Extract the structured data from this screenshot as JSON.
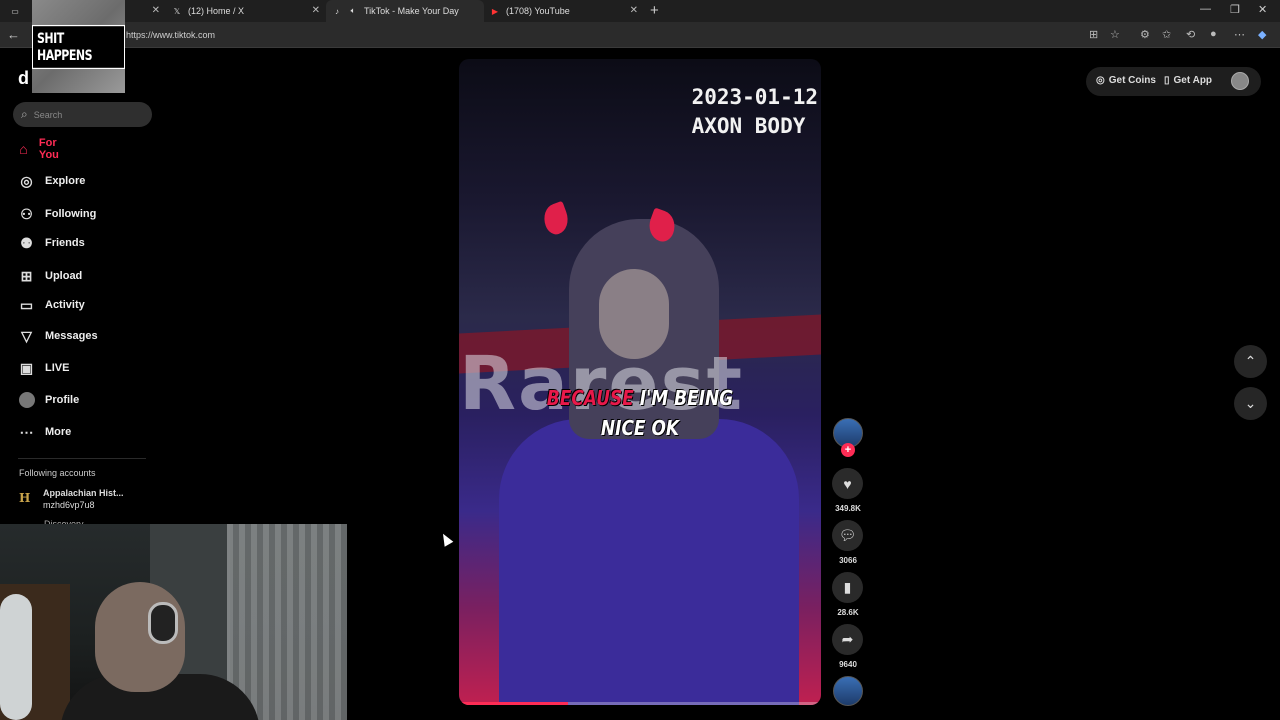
{
  "browser": {
    "tabs": [
      {
        "title": "",
        "favicon": "page-icon"
      },
      {
        "title": "(12) Home / X",
        "favicon": "x-icon"
      },
      {
        "title": "TikTok - Make Your Day",
        "favicon": "tiktok-icon"
      },
      {
        "title": "(1708) YouTube",
        "favicon": "youtube-icon"
      }
    ],
    "url": "https://www.tiktok.com"
  },
  "overlay_logo": "SHIT HAPPENS",
  "sidebar": {
    "search_placeholder": "Search",
    "items": [
      {
        "label": "For You",
        "icon": "home-icon",
        "active": true
      },
      {
        "label": "Explore",
        "icon": "compass-icon"
      },
      {
        "label": "Following",
        "icon": "following-icon"
      },
      {
        "label": "Friends",
        "icon": "friends-icon"
      },
      {
        "label": "Upload",
        "icon": "upload-icon"
      },
      {
        "label": "Activity",
        "icon": "activity-icon"
      },
      {
        "label": "Messages",
        "icon": "messages-icon"
      },
      {
        "label": "LIVE",
        "icon": "live-icon"
      },
      {
        "label": "Profile",
        "icon": "profile-icon"
      },
      {
        "label": "More",
        "icon": "more-icon"
      }
    ],
    "following_header": "Following accounts",
    "accounts": [
      {
        "name": "Appalachian Hist...",
        "handle": "mzhd6vp7u8"
      },
      {
        "name": "Discovery"
      }
    ]
  },
  "video": {
    "timestamp_line1": "2023-01-12",
    "timestamp_line2": "AXON BODY",
    "caption_highlight": "BECAUSE",
    "caption_rest": " I'M BEING",
    "caption_line2": "NICE OK",
    "background_word": "Rarest",
    "progress_fraction": 0.3
  },
  "actions": {
    "likes": "349.8K",
    "comments": "3066",
    "saves": "28.6K",
    "shares": "9640"
  },
  "topright": {
    "get_coins": "Get Coins",
    "get_app": "Get App"
  },
  "colors": {
    "accent": "#fe2c55",
    "background": "#000000",
    "sidebar_text": "#eeeeee"
  }
}
